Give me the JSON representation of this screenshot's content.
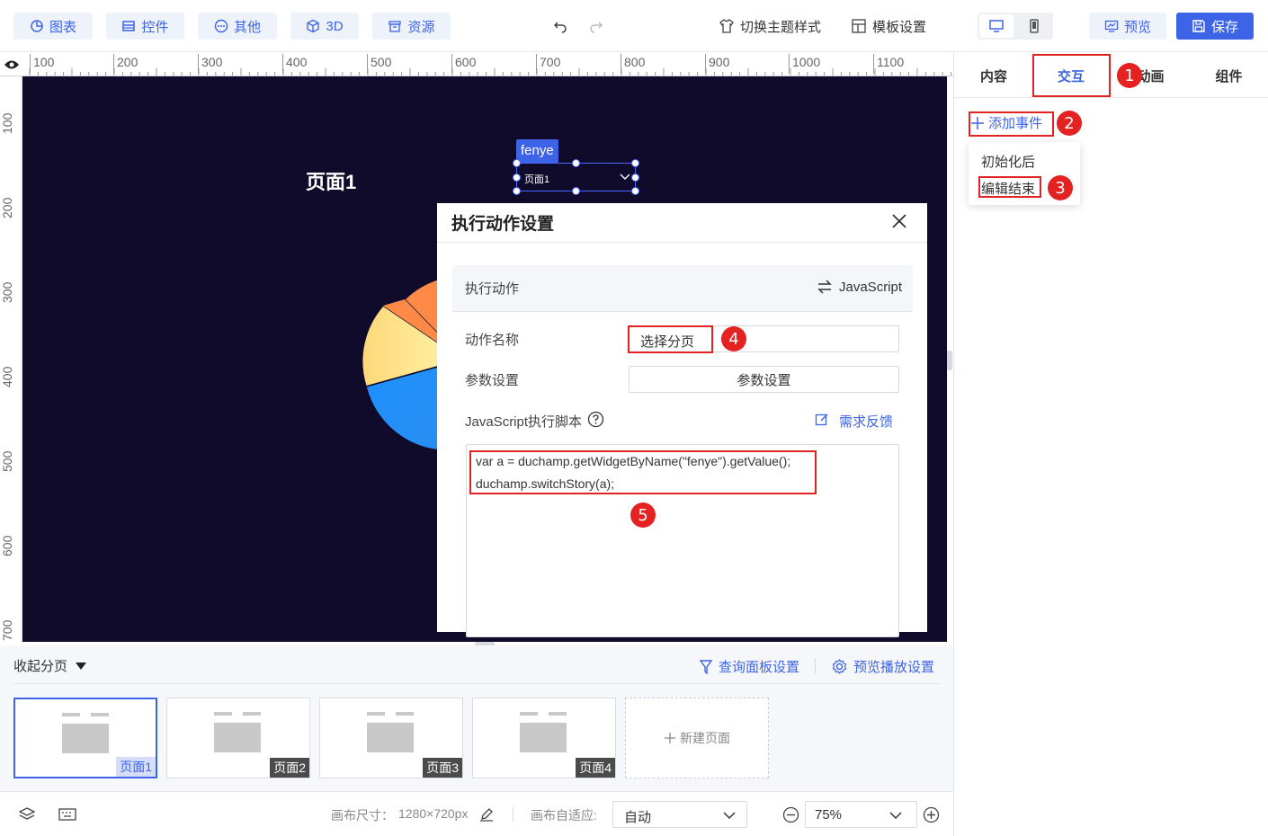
{
  "toolbar": {
    "chart_btn": "图表",
    "widget_btn": "控件",
    "other_btn": "其他",
    "threed_btn": "3D",
    "resource_btn": "资源",
    "theme_btn": "切换主题样式",
    "template_btn": "模板设置",
    "preview_btn": "预览",
    "save_btn": "保存"
  },
  "rulers": {
    "top": [
      "100",
      "200",
      "300",
      "400",
      "500",
      "600",
      "700",
      "800",
      "900",
      "1000",
      "1100"
    ],
    "left": [
      "100",
      "200",
      "300",
      "400",
      "500",
      "600",
      "700"
    ]
  },
  "canvas": {
    "page_title": "页面1",
    "widget_tag": "fenye",
    "widget_value": "页面1"
  },
  "dialog": {
    "title": "执行动作设置",
    "section_label": "执行动作",
    "section_type": "JavaScript",
    "action_name_label": "动作名称",
    "action_name_value": "选择分页",
    "param_label": "参数设置",
    "param_button": "参数设置",
    "script_label": "JavaScript执行脚本",
    "feedback_link": "需求反馈",
    "code_line1": "var a = duchamp.getWidgetByName(\"fenye\").getValue();",
    "code_line2": "duchamp.switchStory(a);"
  },
  "right_panel": {
    "tabs": [
      "内容",
      "交互",
      "动画",
      "组件"
    ],
    "add_event": "添加事件",
    "menu_items": [
      "初始化后",
      "编辑结束"
    ]
  },
  "badges": [
    "1",
    "2",
    "3",
    "4",
    "5"
  ],
  "pages_bar": {
    "collapse_label": "收起分页",
    "query_panel": "查询面板设置",
    "preview_play": "预览播放设置",
    "pages": [
      "页面1",
      "页面2",
      "页面3",
      "页面4"
    ],
    "new_page": "新建页面"
  },
  "statusbar": {
    "canvas_size_label": "画布尺寸：",
    "canvas_size_value": "1280×720px",
    "adapt_label": "画布自适应:",
    "adapt_value": "自动",
    "zoom_value": "75%"
  },
  "colors": {
    "accent": "#3d63e6",
    "canvas_bg": "#100b2b",
    "highlight_red": "#e02424"
  }
}
